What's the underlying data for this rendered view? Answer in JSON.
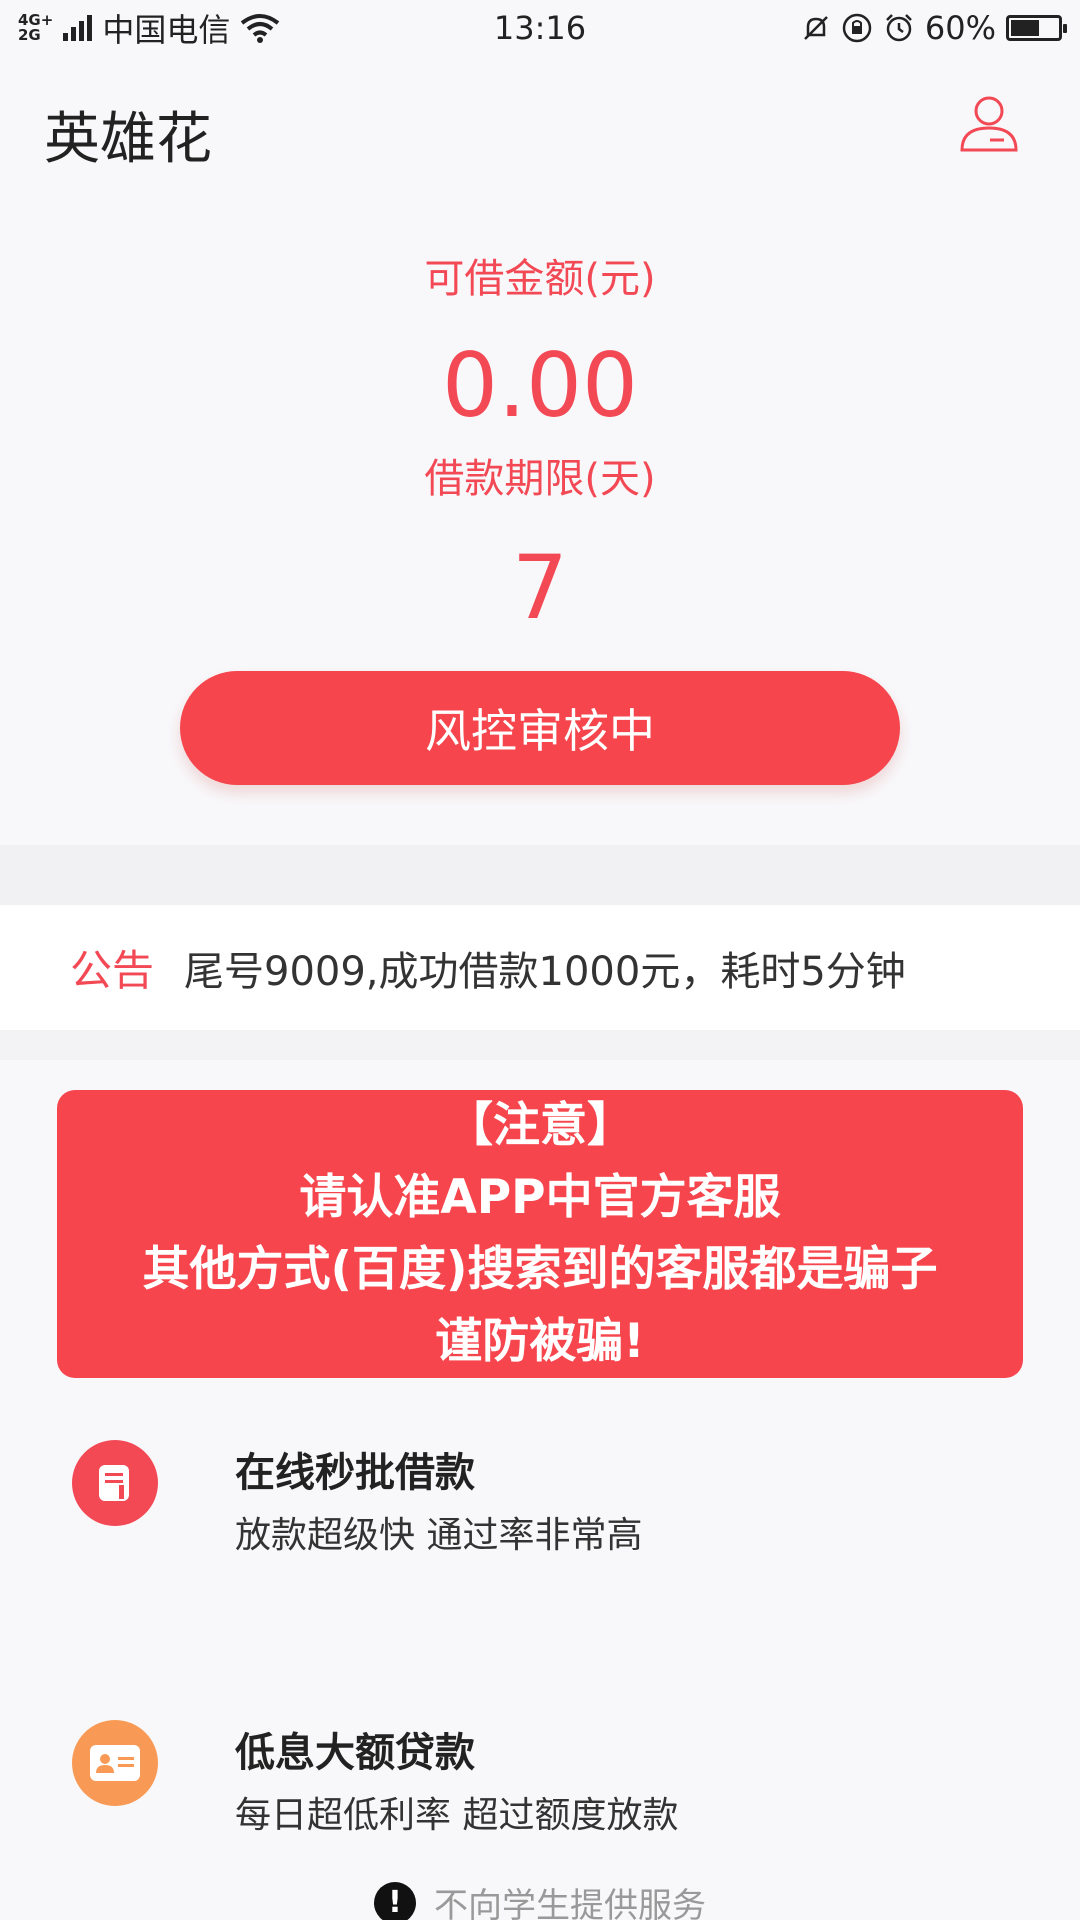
{
  "status_bar": {
    "net_type_top": "4G+",
    "net_type_bottom": "2G",
    "carrier": "中国电信",
    "time": "13:16",
    "battery_percent": "60%",
    "battery_level": 0.6
  },
  "header": {
    "title": "英雄花"
  },
  "hero": {
    "amount_label": "可借金额(元)",
    "amount_value": "0.00",
    "term_label": "借款期限(天)",
    "term_value": "7",
    "button_label": "风控审核中"
  },
  "notice": {
    "tag": "公告",
    "text": "尾号9009,成功借款1000元，耗时5分钟"
  },
  "warning": {
    "line1": "【注意】",
    "line2": "请认准APP中官方客服",
    "line3": "其他方式(百度)搜索到的客服都是骗子",
    "line4": "谨防被骗!"
  },
  "features": [
    {
      "title": "在线秒批借款",
      "desc": "放款超级快  通过率非常高",
      "icon": "document-icon",
      "color": "#f24955"
    },
    {
      "title": "低息大额贷款",
      "desc": "每日超低利率   超过额度放款",
      "icon": "id-card-icon",
      "color": "#f89a55"
    }
  ],
  "footer": {
    "note": "不向学生提供服务"
  },
  "colors": {
    "accent": "#f24955",
    "button": "#f6454d",
    "orange": "#f89a55"
  }
}
